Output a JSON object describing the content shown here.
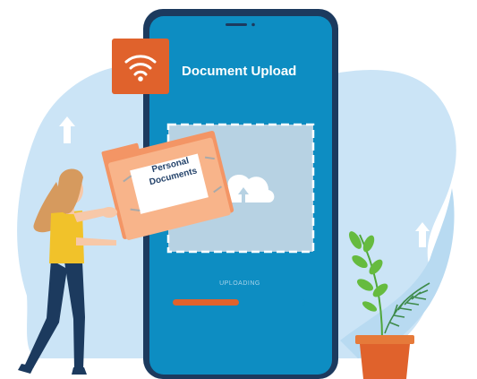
{
  "header": {
    "title": "Document Upload",
    "icon": "wifi-icon"
  },
  "upload": {
    "status_label": "UPLOADING",
    "progress": 0.5,
    "dropzone_icon": "cloud-upload-icon"
  },
  "folder": {
    "label_line1": "Personal",
    "label_line2": "Documents"
  },
  "colors": {
    "accent": "#e0622c",
    "phone_frame": "#1c3a5e",
    "phone_screen": "#0d8dc2",
    "blob": "#c8e3f5",
    "folder": "#f8b48a"
  }
}
